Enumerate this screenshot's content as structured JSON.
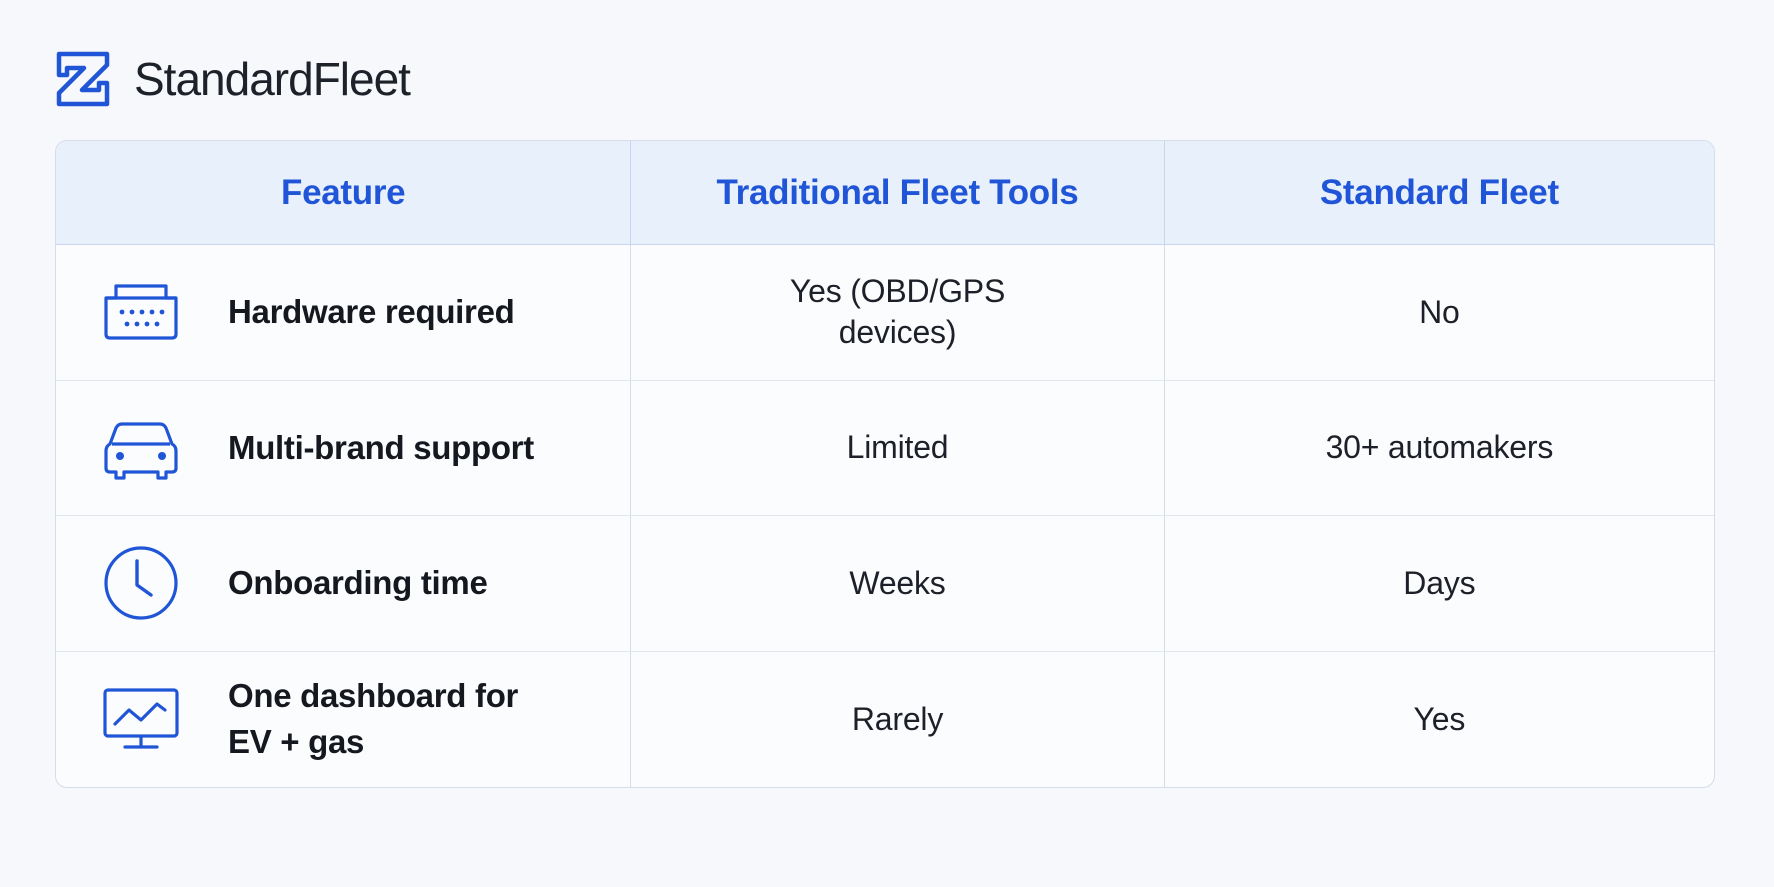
{
  "brand": {
    "name": "StandardFleet",
    "accent_color": "#1f55d6",
    "logo_icon": "standardfleet-logo-icon"
  },
  "table": {
    "headers": [
      "Feature",
      "Traditional Fleet Tools",
      "Standard Fleet"
    ],
    "rows": [
      {
        "icon": "obd-device-icon",
        "feature": "Hardware required",
        "traditional": "Yes (OBD/GPS devices)",
        "standard": "No"
      },
      {
        "icon": "car-icon",
        "feature": "Multi-brand support",
        "traditional": "Limited",
        "standard": "30+ automakers"
      },
      {
        "icon": "clock-icon",
        "feature": "Onboarding time",
        "traditional": "Weeks",
        "standard": "Days"
      },
      {
        "icon": "dashboard-monitor-icon",
        "feature": "One dashboard for EV + gas",
        "traditional": "Rarely",
        "standard": "Yes"
      }
    ]
  }
}
